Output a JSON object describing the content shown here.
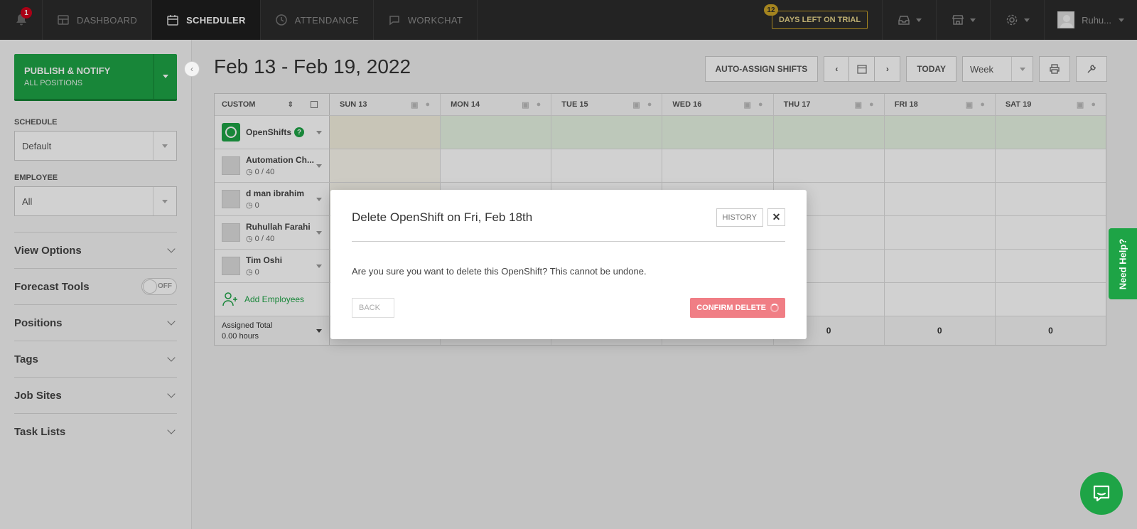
{
  "nav": {
    "notifications_count": "1",
    "tabs": [
      {
        "label": "DASHBOARD",
        "icon": "dashboard-icon"
      },
      {
        "label": "SCHEDULER",
        "icon": "calendar-icon"
      },
      {
        "label": "ATTENDANCE",
        "icon": "clock-icon"
      },
      {
        "label": "WORKCHAT",
        "icon": "chat-icon"
      }
    ],
    "trial_days": "12",
    "trial_label": "DAYS LEFT ON TRIAL",
    "user_name": "Ruhu..."
  },
  "sidebar": {
    "publish_title": "PUBLISH & NOTIFY",
    "publish_subtitle": "ALL POSITIONS",
    "schedule_label": "SCHEDULE",
    "schedule_value": "Default",
    "employee_label": "EMPLOYEE",
    "employee_value": "All",
    "sections": {
      "view_options": "View Options",
      "forecast_tools": "Forecast Tools",
      "forecast_toggle": "OFF",
      "positions": "Positions",
      "tags": "Tags",
      "job_sites": "Job Sites",
      "task_lists": "Task Lists"
    }
  },
  "main": {
    "range_title": "Feb 13 - Feb 19, 2022",
    "auto_assign": "AUTO-ASSIGN SHIFTS",
    "today": "TODAY",
    "view_select": "Week"
  },
  "grid": {
    "sort_label": "CUSTOM",
    "days": [
      "SUN 13",
      "MON 14",
      "TUE 15",
      "WED 16",
      "THU 17",
      "FRI 18",
      "SAT 19"
    ],
    "openshifts_label": "OpenShifts",
    "employees": [
      {
        "name": "Automation Ch...",
        "hours": "0 / 40"
      },
      {
        "name": "d man ibrahim",
        "hours": "0"
      },
      {
        "name": "Ruhullah Farahi",
        "hours": "0 / 40"
      },
      {
        "name": "Tim Oshi",
        "hours": "0"
      }
    ],
    "add_employees": "Add Employees",
    "total_label": "Assigned Total",
    "total_hours": "0.00 hours",
    "totals": [
      "",
      "",
      "",
      "",
      "0",
      "0",
      "0"
    ]
  },
  "modal": {
    "title": "Delete OpenShift on Fri, Feb 18th",
    "history": "HISTORY",
    "message": "Are you sure you want to delete this OpenShift? This cannot be undone.",
    "back": "BACK",
    "confirm": "CONFIRM DELETE"
  },
  "help": {
    "need_help": "Need Help?"
  },
  "colors": {
    "brand_green": "#1ea446",
    "nav_bg": "#2b2b2b",
    "confirm_red": "#f07e85"
  }
}
